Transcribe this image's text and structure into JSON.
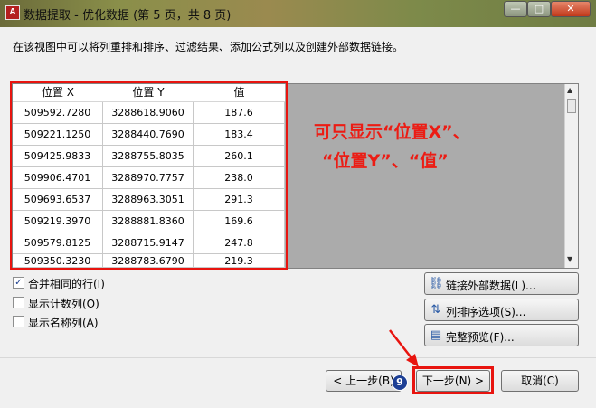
{
  "window": {
    "title": "数据提取 - 优化数据 (第 5 页，共 8 页)",
    "app_logo": "A",
    "minimize_glyph": "—",
    "maximize_glyph": "□",
    "close_glyph": "✕"
  },
  "description": "在该视图中可以将列重排和排序、过滤结果、添加公式列以及创建外部数据链接。",
  "table": {
    "columns": [
      "位置 X",
      "位置 Y",
      "值"
    ],
    "rows": [
      [
        "509592.7280",
        "3288618.9060",
        "187.6"
      ],
      [
        "509221.1250",
        "3288440.7690",
        "183.4"
      ],
      [
        "509425.9833",
        "3288755.8035",
        "260.1"
      ],
      [
        "509906.4701",
        "3288970.7757",
        "238.0"
      ],
      [
        "509693.6537",
        "3288963.3051",
        "291.3"
      ],
      [
        "509219.3970",
        "3288881.8360",
        "169.6"
      ],
      [
        "509579.8125",
        "3288715.9147",
        "247.8"
      ],
      [
        "509350.3230",
        "3288783.6790",
        "219.3"
      ]
    ]
  },
  "annotation": {
    "line1": "可只显示“位置X”、",
    "line2": "“位置Y”、“值”"
  },
  "options": [
    {
      "label": "合并相同的行(I)",
      "checked": true,
      "mark": "✓"
    },
    {
      "label": "显示计数列(O)",
      "checked": false,
      "mark": ""
    },
    {
      "label": "显示名称列(A)",
      "checked": false,
      "mark": ""
    }
  ],
  "side_buttons": [
    {
      "label": "链接外部数据(L)...",
      "icon": "link-icon"
    },
    {
      "label": "列排序选项(S)...",
      "icon": "sort-icon"
    },
    {
      "label": "完整预览(F)...",
      "icon": "preview-icon"
    }
  ],
  "nav": {
    "back": "< 上一步(B)",
    "next": "下一步(N) >",
    "cancel": "取消(C)"
  },
  "step_badge": "9",
  "colors": {
    "highlight_red": "#e8140f",
    "badge_blue": "#1d3f95"
  }
}
